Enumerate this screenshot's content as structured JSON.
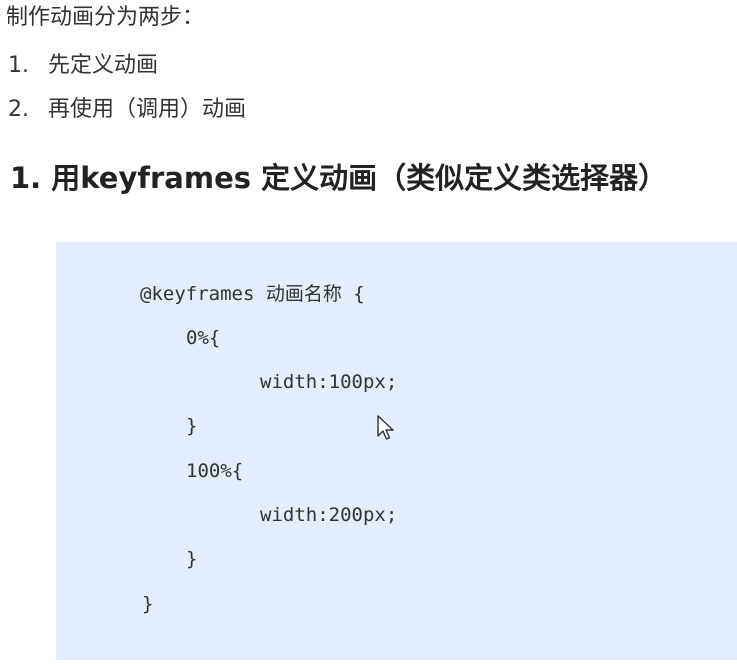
{
  "intro": "制作动画分为两步：",
  "steps": [
    {
      "num": "1.",
      "text": "先定义动画"
    },
    {
      "num": "2.",
      "text": "再使用（调用）动画"
    }
  ],
  "heading": "1. 用keyframes 定义动画（类似定义类选择器）",
  "code": {
    "lines": [
      "@keyframes 动画名称 {",
      "0%{",
      "width:100px;",
      "}",
      "100%{",
      "width:200px;",
      "}",
      "}"
    ]
  },
  "colors": {
    "code_background": "#e3edfc",
    "text": "#333333"
  },
  "icons": {
    "cursor": "mouse-pointer-icon"
  }
}
